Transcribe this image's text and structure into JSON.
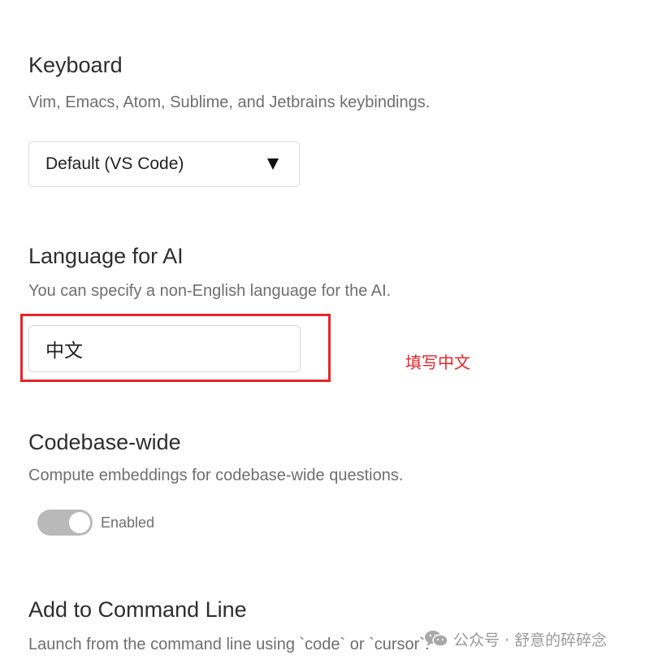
{
  "keyboard": {
    "heading": "Keyboard",
    "description": "Vim, Emacs, Atom, Sublime, and Jetbrains keybindings.",
    "selected": "Default (VS Code)",
    "arrow_icon": "dropdown-triangle-icon"
  },
  "language": {
    "heading": "Language for AI",
    "description": "You can specify a non-English language for the AI.",
    "value": "中文",
    "annotation": "填写中文",
    "highlight_color": "#e3262b"
  },
  "codebase": {
    "heading": "Codebase-wide",
    "description": "Compute embeddings for codebase-wide questions.",
    "toggle_on": true,
    "toggle_label": "Enabled"
  },
  "command_line": {
    "heading": "Add to Command Line",
    "description": "Launch from the command line using `code` or `cursor`."
  },
  "watermark": {
    "icon": "wechat-icon",
    "text": "公众号 · 舒意的碎碎念"
  }
}
